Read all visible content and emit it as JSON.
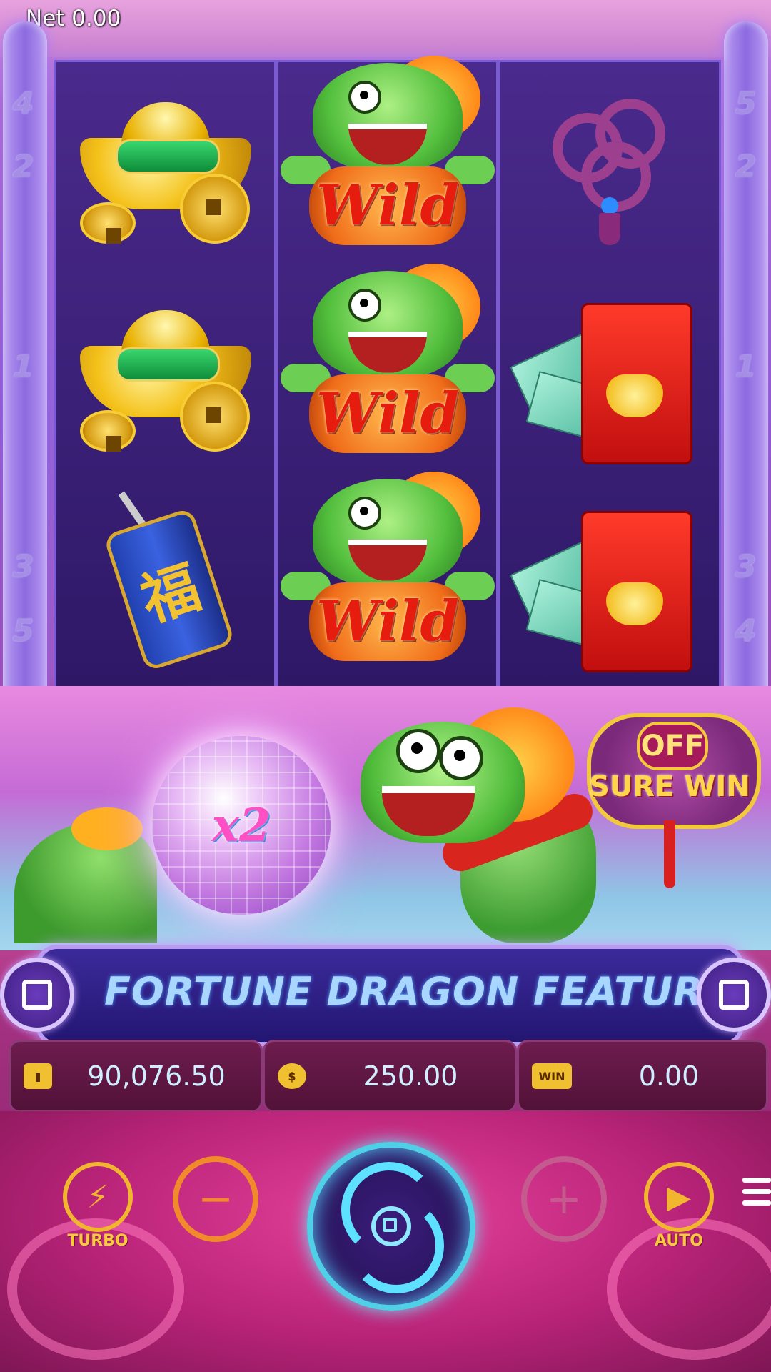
{
  "header": {
    "net_label": "Net 0.00"
  },
  "line_numbers": {
    "left": [
      "4",
      "2",
      "1",
      "3",
      "5"
    ],
    "right": [
      "5",
      "2",
      "1",
      "3",
      "4"
    ]
  },
  "reels": [
    [
      "gold-ingot",
      "gold-ingot",
      "firecracker"
    ],
    [
      "wild-dragon",
      "wild-dragon",
      "wild-dragon"
    ],
    [
      "chinese-knot",
      "red-envelope",
      "red-envelope"
    ]
  ],
  "symbols": {
    "wild_label": "Wild",
    "firecracker_glyph": "福"
  },
  "feature": {
    "multiplier": "x2",
    "sure_win_state": "OFF",
    "sure_win_label": "SURE WIN"
  },
  "ticker": {
    "text": "FORTUNE DRAGON FEATURE MAY BE RA"
  },
  "info_bar": {
    "balance": "90,076.50",
    "bet": "250.00",
    "win_icon": "WIN",
    "win": "0.00"
  },
  "controls": {
    "turbo_label": "TURBO",
    "auto_label": "AUTO",
    "minus_glyph": "−",
    "plus_glyph": "+",
    "turbo_glyph": "⚡",
    "auto_glyph": "▶"
  },
  "colors": {
    "accent_gold": "#f2b52e",
    "spin_glow": "#4fd0e6",
    "ticker_text": "#a9d6ff"
  }
}
